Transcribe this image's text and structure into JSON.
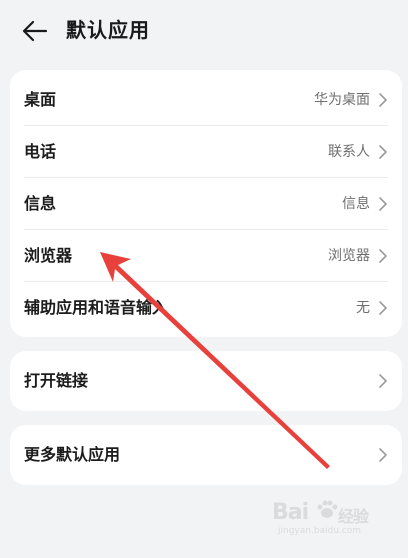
{
  "header": {
    "title": "默认应用",
    "back_icon": "arrow-left-icon"
  },
  "default_apps": {
    "rows": [
      {
        "label": "桌面",
        "value": "华为桌面"
      },
      {
        "label": "电话",
        "value": "联系人"
      },
      {
        "label": "信息",
        "value": "信息"
      },
      {
        "label": "浏览器",
        "value": "浏览器"
      },
      {
        "label": "辅助应用和语音输入",
        "value": "无"
      }
    ]
  },
  "open_links": {
    "label": "打开链接"
  },
  "more_defaults": {
    "label": "更多默认应用"
  },
  "colors": {
    "background": "#f1f3f5",
    "card": "#ffffff",
    "annotation_arrow": "#e8413c",
    "secondary_text": "#6f6f6f"
  },
  "watermark": {
    "logo_text": "Bai",
    "logo_suffix": "经验",
    "url": "jingyan.baidu.com"
  }
}
